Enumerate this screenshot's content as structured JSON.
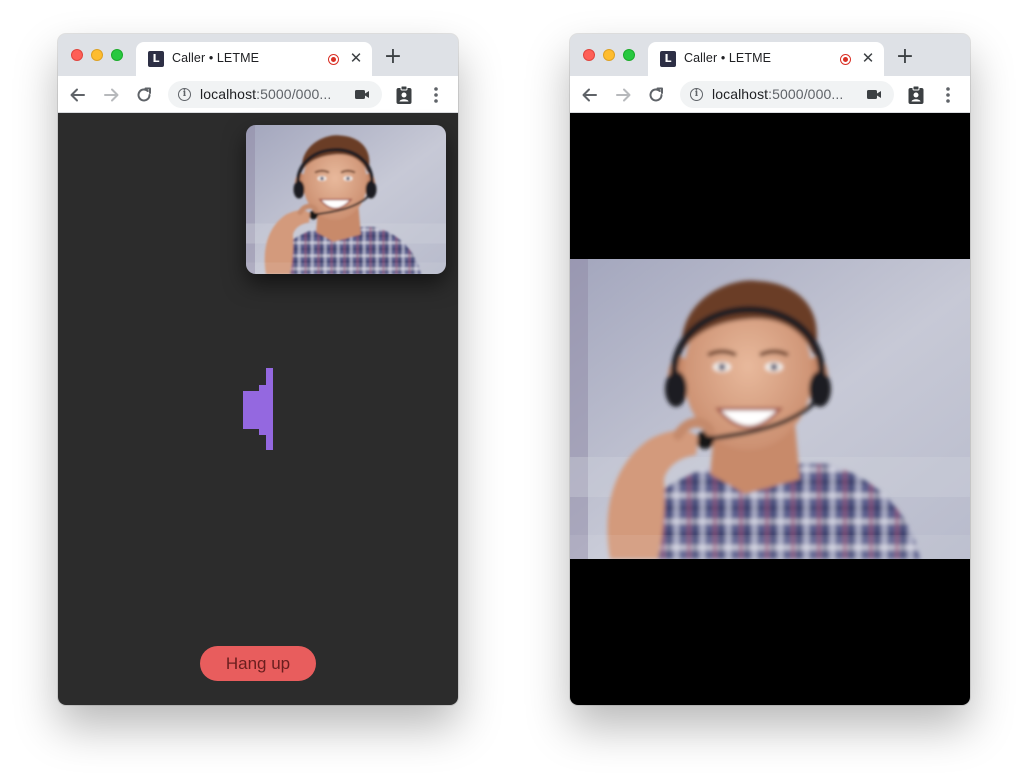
{
  "windows": [
    {
      "tab": {
        "favicon_letter": "L",
        "title": "Caller • LETME",
        "close_glyph": "✕",
        "new_tab_glyph": "+"
      },
      "address": {
        "host": "localhost",
        "rest": ":5000/000..."
      },
      "icons": [
        "back-arrow-icon",
        "forward-arrow-icon",
        "reload-icon",
        "info-icon",
        "camera-icon",
        "badge-icon",
        "kebab-menu-icon",
        "recording-icon"
      ],
      "content": {
        "background": "#2c2c2c",
        "self_view": "webcam-feed",
        "audio_level_icon": "speaker-volume-icon",
        "audio_level_color": "#9468e0",
        "hangup_label": "Hang up",
        "hangup_color": "#e85d5d"
      }
    },
    {
      "tab": {
        "favicon_letter": "L",
        "title": "Caller • LETME",
        "close_glyph": "✕",
        "new_tab_glyph": "+"
      },
      "address": {
        "host": "localhost",
        "rest": ":5000/000..."
      },
      "icons": [
        "back-arrow-icon",
        "forward-arrow-icon",
        "reload-icon",
        "info-icon",
        "camera-icon",
        "badge-icon",
        "kebab-menu-icon",
        "recording-icon"
      ],
      "content": {
        "background": "#000000",
        "remote_view": "webcam-feed"
      }
    }
  ]
}
